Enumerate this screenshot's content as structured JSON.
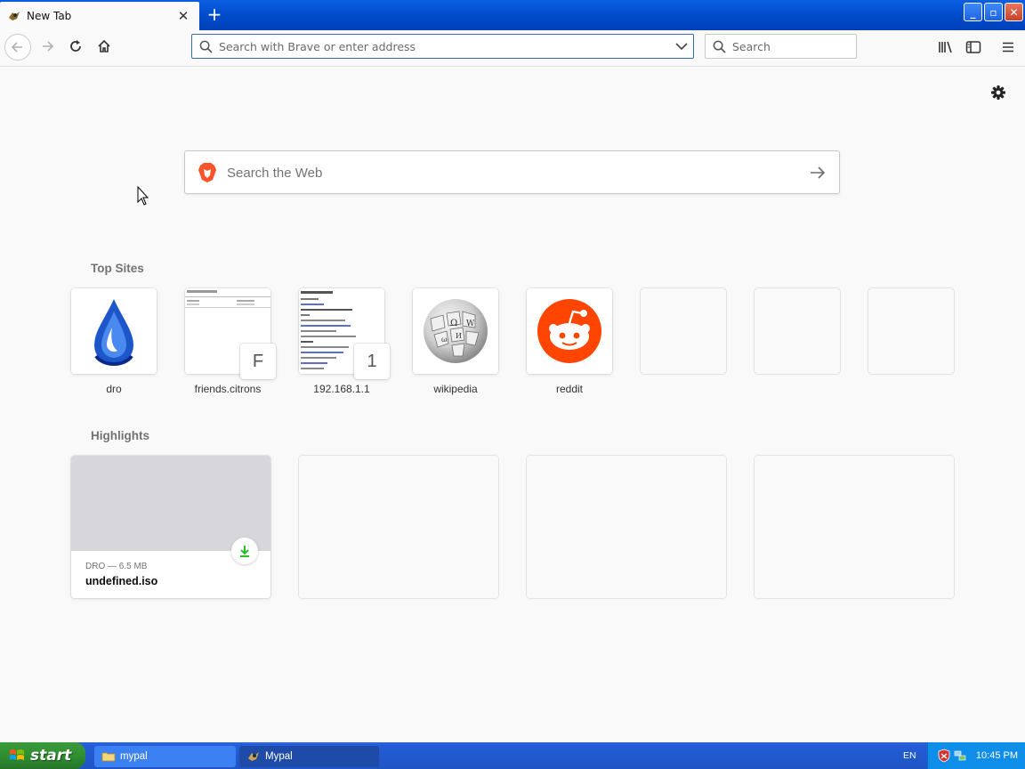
{
  "tab": {
    "title": "New Tab",
    "favicon": "mypal-icon"
  },
  "toolbar": {
    "url_placeholder": "Search with Brave or enter address",
    "search_placeholder": "Search"
  },
  "content": {
    "web_search_placeholder": "Search the Web",
    "top_sites_title": "Top Sites",
    "highlights_title": "Highlights",
    "top_sites": [
      {
        "label": "dro",
        "icon": "droplet-logo"
      },
      {
        "label": "friends.citrons",
        "letter": "F"
      },
      {
        "label": "192.168.1.1",
        "letter": "1"
      },
      {
        "label": "wikipedia",
        "icon": "wikipedia-globe"
      },
      {
        "label": "reddit",
        "icon": "reddit-logo"
      }
    ],
    "highlight": {
      "meta": "DRO — 6.5 MB",
      "filename": "undefined.iso"
    }
  },
  "taskbar": {
    "start": "start",
    "tasks": [
      {
        "label": "mypal"
      },
      {
        "label": "Mypal"
      }
    ],
    "lang": "EN",
    "clock": "10:45 PM"
  },
  "colors": {
    "title_bar": "#0a5fe0",
    "reddit": "#ff4500",
    "brave": "#fb542b",
    "download_green": "#2ac02a"
  }
}
